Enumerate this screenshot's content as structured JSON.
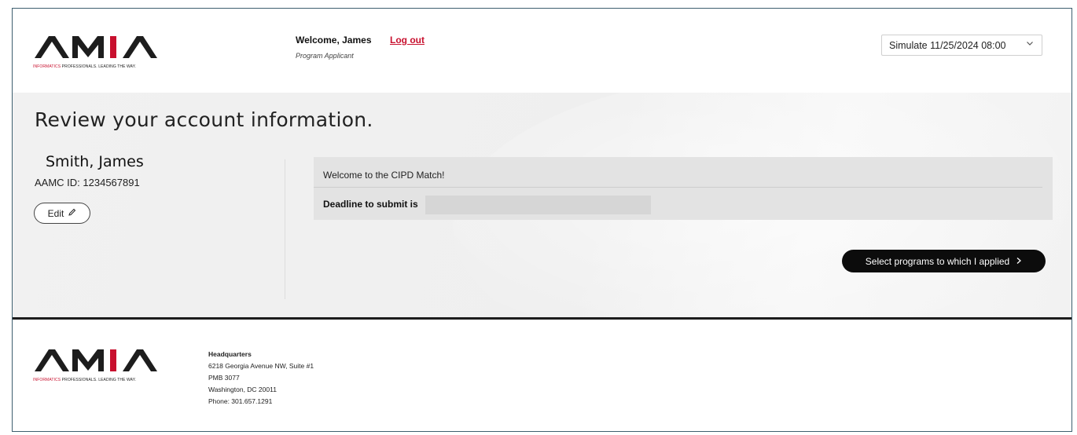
{
  "brand": {
    "logo_text": "AMIA",
    "tagline_red": "INFORMATICS",
    "tagline_rest": " PROFESSIONALS. LEADING THE WAY.",
    "accent_red": "#c8102e",
    "dark": "#1d1d1d"
  },
  "header": {
    "welcome": "Welcome, James",
    "logout": "Log out",
    "role": "Program Applicant",
    "simulate": "Simulate 11/25/2024 08:00",
    "simulate_icon": "chevron-down-icon"
  },
  "main": {
    "title": "Review your account information.",
    "user_name": "Smith, James",
    "user_id": "AAMC ID: 1234567891",
    "edit_label": "Edit",
    "edit_icon": "pencil-icon",
    "welcome_msg": "Welcome to the CIPD Match!",
    "deadline_label": "Deadline to submit is",
    "select_button": "Select programs to which I applied",
    "select_icon": "chevron-right-icon"
  },
  "footer": {
    "hq_title": "Headquarters",
    "address1": "6218 Georgia Avenue NW, Suite #1",
    "address2": "PMB 3077",
    "address3": "Washington, DC 20011",
    "phone": "Phone: 301.657.1291"
  }
}
